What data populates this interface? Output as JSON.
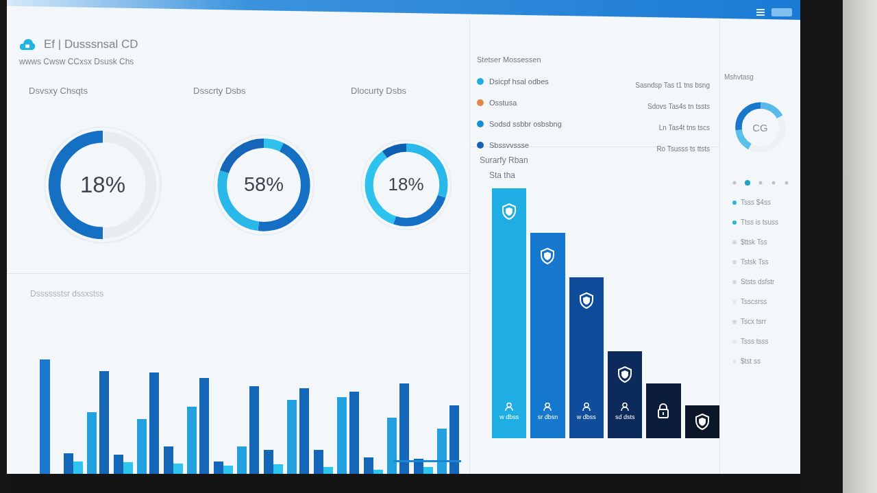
{
  "header": {
    "title": "Ef | Dusssnsal CD",
    "subtitle": "wwws Cwsw CCxsx Dsusk Chs"
  },
  "gauges": [
    {
      "title": "Dsvsxy Chsqts",
      "value": "18%",
      "kind": "half"
    },
    {
      "title": "Dsscrty Dsbs",
      "value": "58%",
      "kind": "ring"
    },
    {
      "title": "Dlocurty Dsbs",
      "value": "18%",
      "kind": "ring"
    }
  ],
  "activity_chart": {
    "title": "Dsssssstsr dssxstss"
  },
  "legend_panel": {
    "title": "Stetser Mossessen",
    "items": [
      {
        "label": "Dsicpf hsal odbes",
        "color": "#27a9e1",
        "detail": "Sasndsp Tas t1 tns bsng"
      },
      {
        "label": "Osstusa",
        "color": "#e0884a",
        "detail": "Sdovs Tas4s tn tssts"
      },
      {
        "label": "Sodsd ssbbr osbsbng",
        "color": "#1a8fd0",
        "detail": "Ln Tas4t tns tscs"
      },
      {
        "label": "Sbssvvssse",
        "color": "#1763b0",
        "detail": "Ro Tsusss ts ttsts"
      }
    ]
  },
  "security_chart": {
    "title": "Surarfy Rban",
    "subtitle": "Sta tha",
    "bars": [
      {
        "color": "#1eaee3",
        "caption": "w dbss"
      },
      {
        "color": "#1677cf",
        "caption": "sr dbsn"
      },
      {
        "color": "#0f4c9c",
        "caption": "w dbss"
      },
      {
        "color": "#0c2a5c",
        "caption": "sd dsts"
      },
      {
        "color": "#0b1c3b"
      },
      {
        "color": "#0c1629"
      }
    ]
  },
  "side_panel": {
    "title": "Mshvtasg",
    "gauge": {
      "value": "CG",
      "kind": "arc"
    },
    "tabs": [
      {
        "selected": false
      },
      {
        "selected": true
      },
      {
        "selected": false
      },
      {
        "selected": false
      },
      {
        "selected": false
      }
    ],
    "items": [
      {
        "label": "Tsss $4ss",
        "color": "#2bb6c8"
      },
      {
        "label": "Ttss is tsuss",
        "color": "#2bb6c8"
      },
      {
        "label": "$ttsk Tss",
        "color": "#d3dae0"
      },
      {
        "label": "Tstsk Tss",
        "color": "#d3dae0"
      },
      {
        "label": "Ststs dsfstr",
        "color": "#d3dae0"
      },
      {
        "label": "Tsscsrss",
        "color": "#e6eaee"
      },
      {
        "label": "Tscx tsrr",
        "color": "#d3dae0"
      },
      {
        "label": "Tsss tsss",
        "color": "#e6eaee"
      },
      {
        "label": "$tst ss",
        "color": "#e6eaee"
      }
    ]
  }
}
